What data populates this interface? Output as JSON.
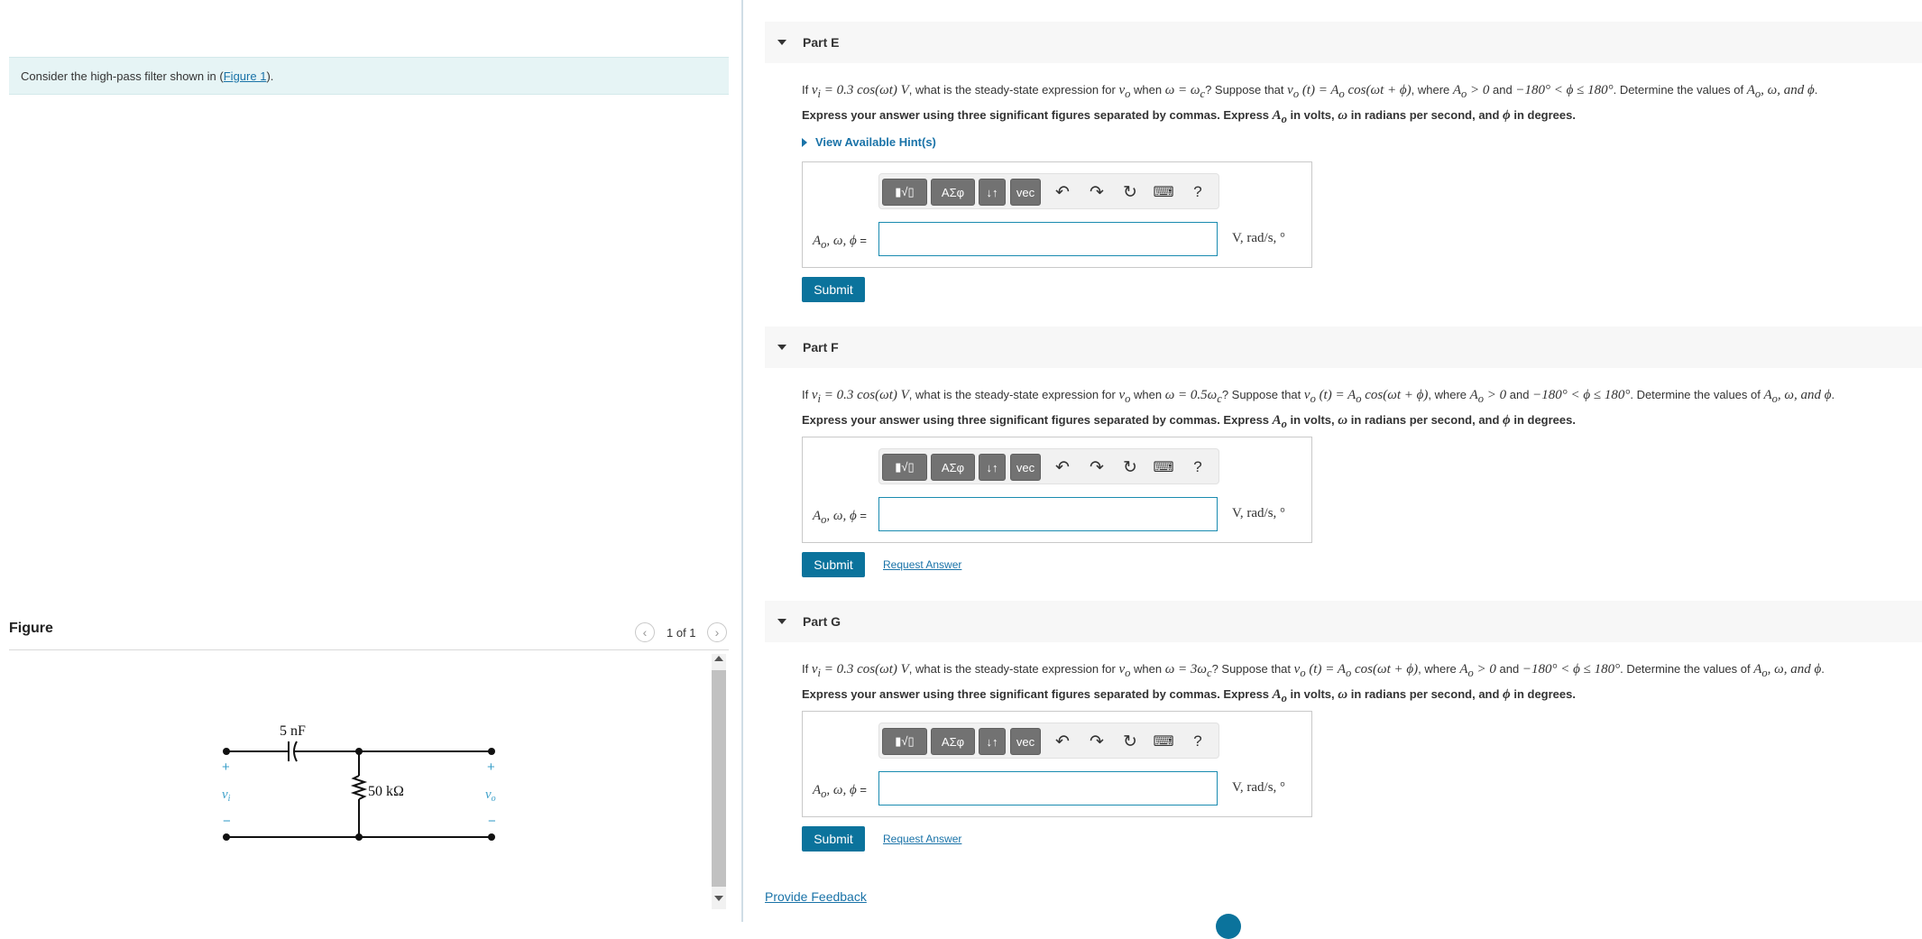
{
  "left": {
    "prompt_prefix": "Consider the high-pass filter shown in (",
    "prompt_link": "Figure 1",
    "prompt_suffix": ").",
    "figure_title": "Figure",
    "figure_counter": "1 of 1",
    "circuit": {
      "capacitor_label": "5 nF",
      "resistor_label": "50 kΩ",
      "input_label": "v",
      "input_sub": "i",
      "output_label": "v",
      "output_sub": "o",
      "plus": "+",
      "minus": "−"
    }
  },
  "toolbar": {
    "templates": "▮√▯",
    "greek": "ΑΣφ",
    "updown": "↓↑",
    "vec": "vec",
    "help": "?"
  },
  "parts": [
    {
      "title": "Part E",
      "omega_expr": "ω = ω",
      "omega_sub": "c",
      "hint": "View Available Hint(s)",
      "submit": "Submit"
    },
    {
      "title": "Part F",
      "omega_expr": "ω = 0.5ω",
      "omega_sub": "c",
      "submit": "Submit",
      "request": "Request Answer"
    },
    {
      "title": "Part G",
      "omega_expr": "ω = 3ω",
      "omega_sub": "c",
      "submit": "Submit",
      "request": "Request Answer"
    }
  ],
  "common": {
    "q_if": "If ",
    "q_vi": "v",
    "q_vi_sub": "i",
    "q_vi_eq": " = 0.3 cos(ωt) V",
    "q_mid1": ", what is the steady-state expression for ",
    "q_vo": "v",
    "q_vo_sub": "o",
    "q_when": " when ",
    "q_suppose": "? Suppose that ",
    "q_vot": " (t) = A",
    "q_o": "o",
    "q_cos": " cos(ωt + ϕ)",
    "q_where": ", where ",
    "q_A": "A",
    "q_gt0": " > 0",
    "q_and": " and ",
    "q_range": "−180° < ϕ ≤ 180°",
    "q_determine": ". Determine the values of ",
    "q_list": ", ω, and ϕ",
    "q_end": ".",
    "note_a": "Express your answer using three significant figures separated by commas. Express ",
    "note_b": " in volts, ",
    "note_w": "ω",
    "note_c": " in radians per second, and ",
    "note_p": "ϕ",
    "note_d": " in degrees.",
    "ans_label_a": "A",
    "ans_label_sub": "o",
    "ans_label_b": ", ω, ϕ",
    "ans_eq": " =",
    "units": "V, rad/s, °"
  },
  "footer": {
    "feedback": "Provide Feedback"
  }
}
